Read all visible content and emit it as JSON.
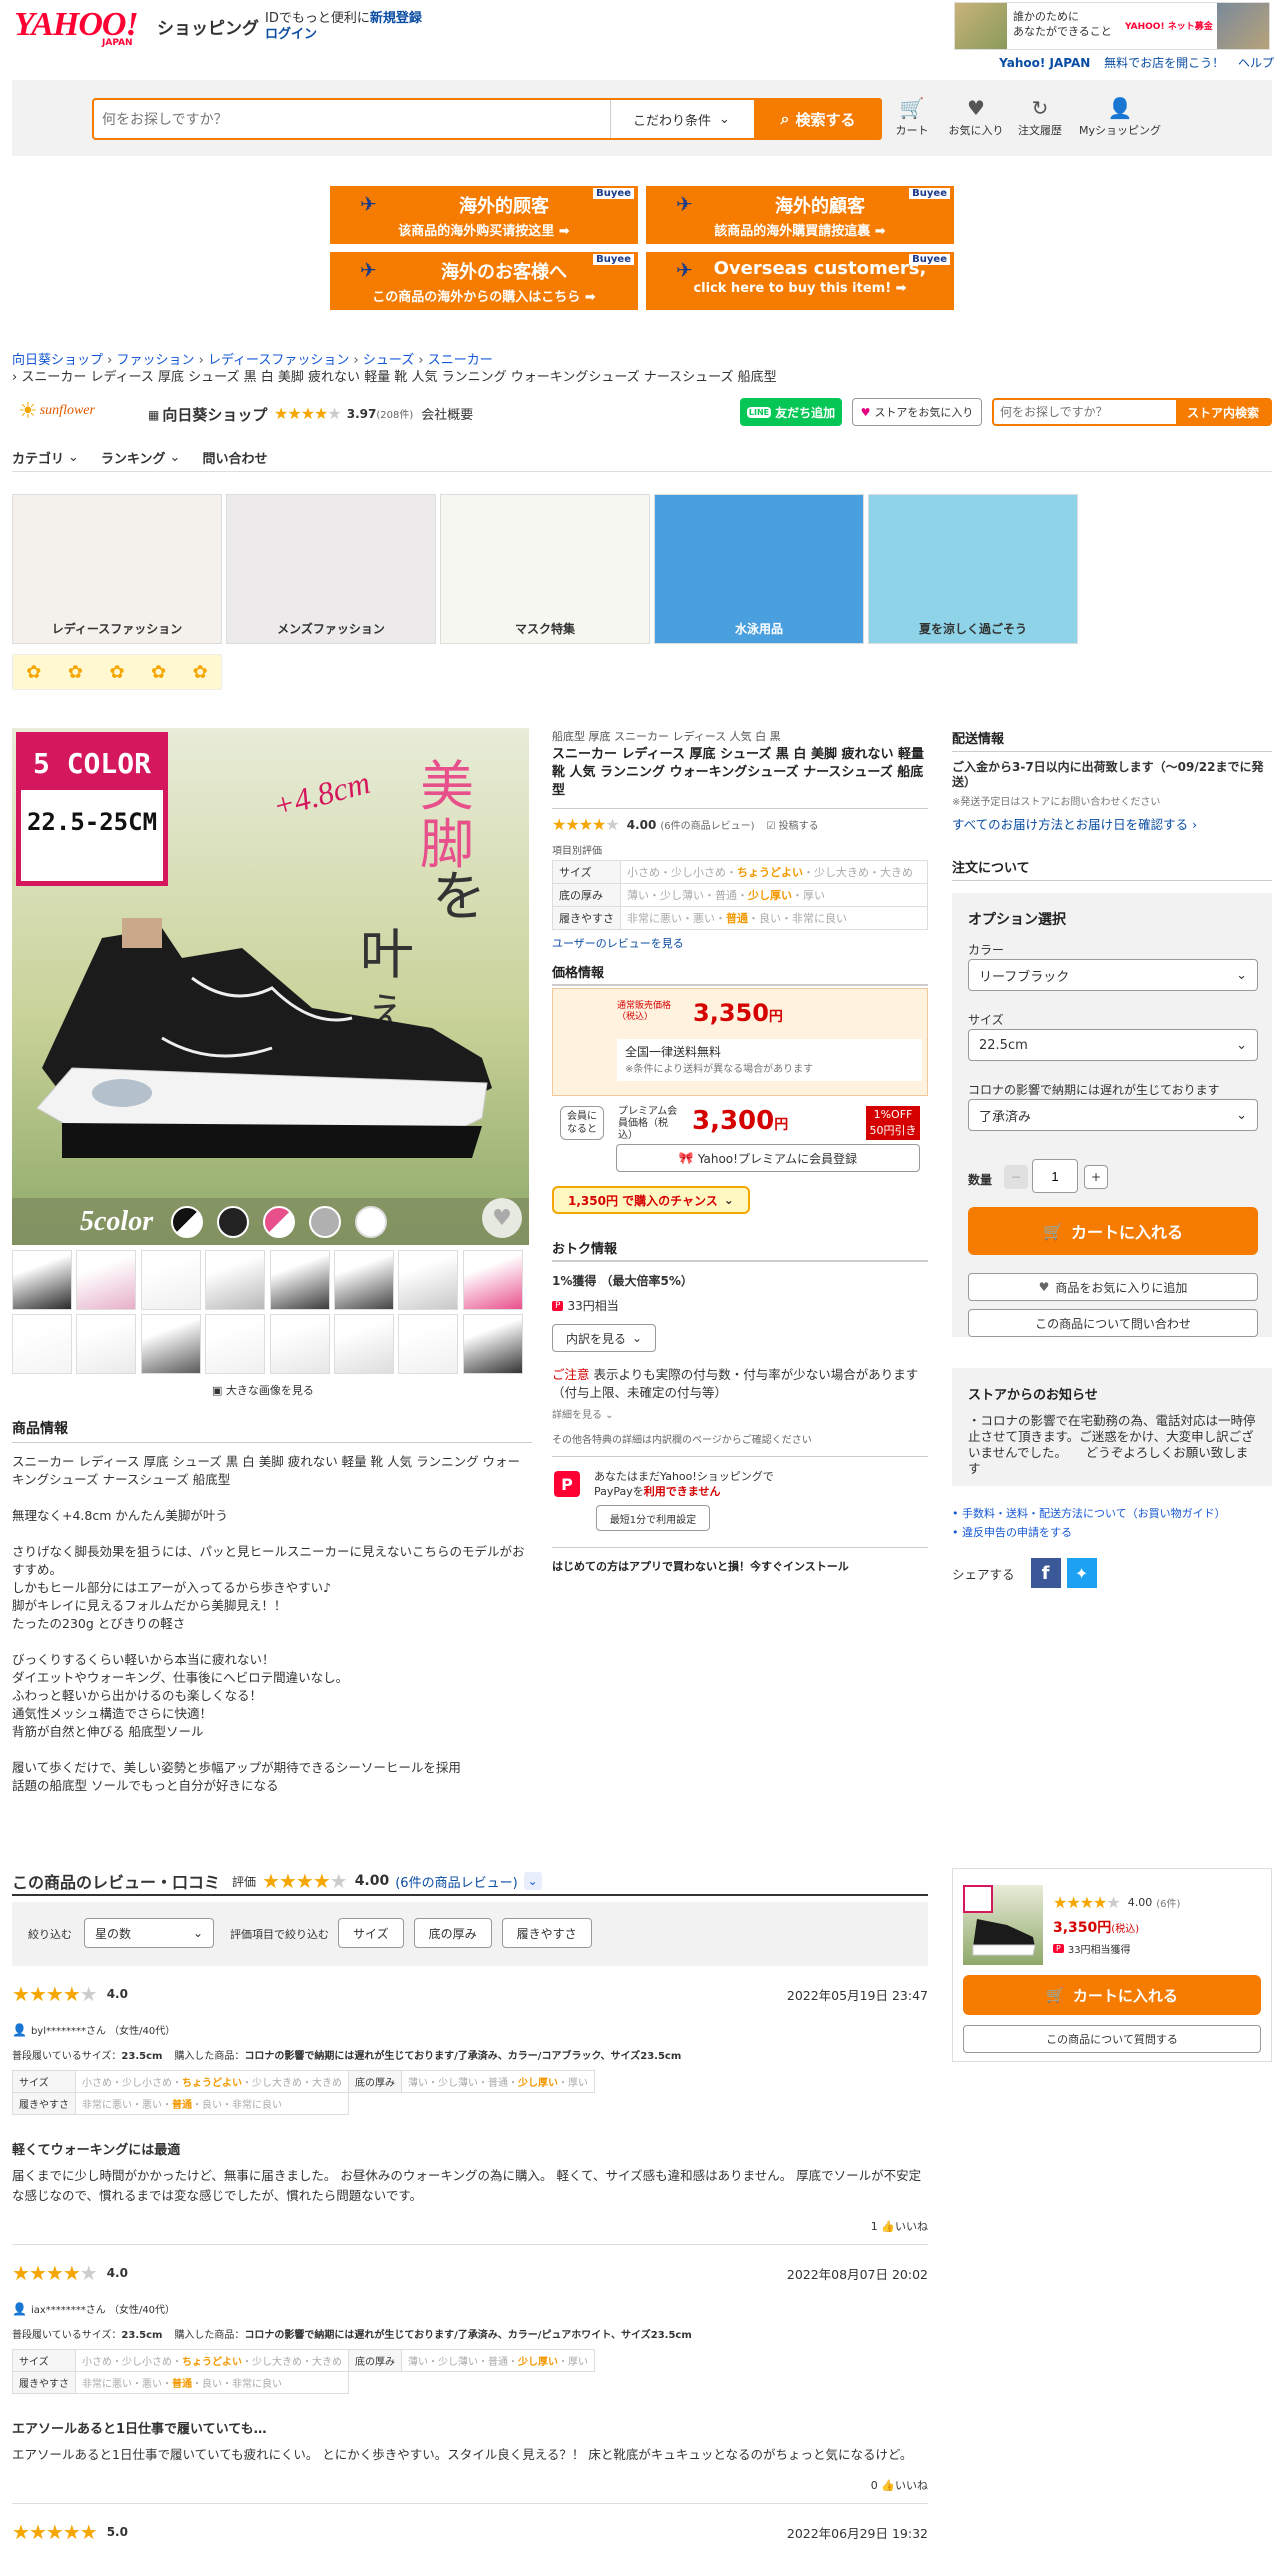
{
  "header": {
    "logo_main": "YAHOO!",
    "logo_sub": "JAPAN",
    "logo_shop": "ショッピング",
    "id_promo": "IDでもっと便利に",
    "new_reg": "新規登録",
    "login": "ログイン",
    "ad_line1": "誰かのために",
    "ad_line2": "あなたができること",
    "ad_brand": "YAHOO! ネット募金",
    "yj_link": "Yahoo! JAPAN",
    "open_store": "無料でお店を開こう！",
    "help": "ヘルプ"
  },
  "search": {
    "placeholder": "何をお探しですか？",
    "condition": "こだわり条件",
    "button": "検索する",
    "icons": [
      {
        "icon": "cart-icon",
        "label": "カート"
      },
      {
        "icon": "heart-icon",
        "label": "お気に入り"
      },
      {
        "icon": "history-icon",
        "label": "注文履歴"
      },
      {
        "icon": "user-icon",
        "label": "Myショッピング"
      }
    ]
  },
  "buyee": [
    {
      "title": "海外的顾客",
      "sub": "该商品的海外购买请按这里 ➡",
      "brand": "Buyee"
    },
    {
      "title": "海外的顧客",
      "sub": "該商品的海外購買請按這裏 ➡",
      "brand": "Buyee"
    },
    {
      "title": "海外のお客様へ",
      "sub": "この商品の海外からの購入はこちら ➡",
      "brand": "Buyee"
    },
    {
      "title": "Overseas customers,",
      "sub": "click here to buy this item! ➡",
      "brand": "Buyee"
    }
  ],
  "breadcrumb": {
    "items": [
      "向日葵ショップ",
      "ファッション",
      "レディースファッション",
      "シューズ",
      "スニーカー"
    ],
    "current": "スニーカー レディース 厚底 シューズ 黒 白 美脚 疲れない 軽量 靴 人気 ランニング ウォーキングシューズ ナースシューズ 船底型"
  },
  "store": {
    "logo_text": "sunflower",
    "name": "向日葵ショップ",
    "rating": "3.97",
    "count": "(208件)",
    "overview": "会社概要",
    "line_btn": "友だち追加",
    "fav_btn": "ストアをお気に入り",
    "search_placeholder": "何をお探しですか？",
    "search_btn": "ストア内検索"
  },
  "store_nav": [
    "カテゴリ",
    "ランキング",
    "問い合わせ"
  ],
  "banners": [
    {
      "label": "レディースファッション",
      "bg": "#f4f1ec"
    },
    {
      "label": "メンズファッション",
      "bg": "#eceaea"
    },
    {
      "label": "マスク特集",
      "bg": "#f7f7f2"
    },
    {
      "label": "水泳用品",
      "bg": "#4aa0df"
    },
    {
      "label": "夏を涼しく過ごそう",
      "bg": "#8fd3e8"
    }
  ],
  "main_image": {
    "badge_top": "5 COLOR",
    "badge_size": "22.5-25CM",
    "plus": "+4.8cm",
    "kanji1": "美",
    "kanji2": "脚",
    "kanji3": "を",
    "kanji4": "叶",
    "kanji5": "える",
    "color_label": "5color",
    "enlarge": "大きな画像を見る"
  },
  "product": {
    "subtitle": "船底型 厚底 スニーカー レディース 人気 白 黒",
    "title": "スニーカー レディース 厚底 シューズ 黒 白 美脚 疲れない 軽量 靴 人気 ランニング ウォーキングシューズ ナースシューズ 船底型",
    "rating": "4.00",
    "review_count": "(6件の商品レビュー)",
    "post_review": "投稿する",
    "eval_title": "項目別評価",
    "evals": [
      {
        "name": "サイズ",
        "opts": [
          "小さめ",
          "少し小さめ"
        ],
        "sel": "ちょうどよい",
        "opts2": [
          "少し大きめ",
          "大きめ"
        ]
      },
      {
        "name": "底の厚み",
        "opts": [
          "薄い",
          "少し薄い",
          "普通"
        ],
        "sel": "少し厚い",
        "opts2": [
          "厚い"
        ]
      },
      {
        "name": "履きやすさ",
        "opts": [
          "非常に悪い",
          "悪い"
        ],
        "sel": "普通",
        "opts2": [
          "良い",
          "非常に良い"
        ]
      }
    ],
    "user_reviews_link": "ユーザーのレビューを見る"
  },
  "price": {
    "title": "価格情報",
    "normal_label": "通常販売価格（税込）",
    "normal_price": "3,350",
    "yen": "円",
    "shipping": "全国一律送料無料",
    "shipping_note": "※条件により送料が異なる場合があります",
    "member_q": "会員になると",
    "premium_label": "プレミアム会員価格（税込）",
    "premium_price": "3,300",
    "off_badge": "1%OFF",
    "off_yen": "50円引き",
    "premium_btn": "Yahoo!プレミアムに会員登録",
    "chance": "1,350円 で購入のチャンス"
  },
  "deal": {
    "title": "おトク情報",
    "gain": "1%獲得 （最大倍率5%）",
    "points": "33円相当",
    "details_btn": "内訳を見る",
    "caution_label": "ご注意",
    "caution": "表示よりも実際の付与数・付与率が少ない場合があります（付与上限、未確定の付与等）",
    "detail_link": "詳細を見る",
    "other": "その他各特典の詳細は内訳欄のページからご確認ください",
    "paypay_line1": "あなたはまだYahoo!ショッピングで",
    "paypay_line2": "PayPayを",
    "paypay_emph": "利用できません",
    "paypay_btn": "最短1分で利用設定",
    "app_promo": "はじめての方はアプリで買わないと損！今すぐインストール"
  },
  "shipping": {
    "title": "配送情報",
    "text": "ご入金から3-7日以内に出荷致します（〜09/22までに発送）",
    "note": "※発送予定日はストアにお問い合わせください",
    "link": "すべてのお届け方法とお届け日を確認する"
  },
  "order": {
    "title": "注文について",
    "option_title": "オプション選択",
    "color_label": "カラー",
    "color_value": "リーフブラック",
    "size_label": "サイズ",
    "size_value": "22.5cm",
    "covid_label": "コロナの影響で納期には遅れが生じております",
    "covid_value": "了承済み",
    "qty_label": "数量",
    "qty_value": "1",
    "cart_btn": "カートに入れる",
    "fav_btn": "商品をお気に入りに追加",
    "inquiry_btn": "この商品について問い合わせ"
  },
  "notice": {
    "title": "ストアからのお知らせ",
    "text": "・コロナの影響で在宅勤務の為、電話対応は一時停止させて頂きます。ご迷惑をかけ、大変申し訳ございませんでした。　　どうぞよろしくお願い致します",
    "links": [
      "手数料・送料・配送方法について（お買い物ガイド）",
      "違反申告の申請をする"
    ],
    "share": "シェアする"
  },
  "description": {
    "title": "商品情報",
    "paragraphs": [
      "スニーカー レディース 厚底 シューズ 黒 白 美脚 疲れない 軽量 靴 人気 ランニング ウォーキングシューズ ナースシューズ 船底型",
      "無理なく+4.8cm かんたん美脚が叶う",
      "さりげなく脚長効果を狙うには、パッと見ヒールスニーカーに見えないこちらのモデルがおすすめ。\nしかもヒール部分にはエアーが入ってるから歩きやすい♪\n脚がキレイに見えるフォルムだから美脚見え！！\nたったの230g とびきりの軽さ",
      "びっくりするくらい軽いから本当に疲れない！\nダイエットやウォーキング、仕事後にへビロテ間違いなし。\nふわっと軽いから出かけるのも楽しくなる！\n通気性メッシュ構造でさらに快適！\n背筋が自然と伸びる 船底型ソール",
      "履いて歩くだけで、美しい姿勢と歩幅アップが期待できるシーソーヒールを採用\n話題の船底型 ソールでもっと自分が好きになる"
    ]
  },
  "reviews": {
    "title": "この商品のレビュー・口コミ",
    "eval_label": "評価",
    "rating": "4.00",
    "count_link": "(6件の商品レビュー)",
    "filter_label": "絞り込む",
    "filter_value": "星の数",
    "item_filter_label": "評価項目で絞り込む",
    "item_filters": [
      "サイズ",
      "底の厚み",
      "履きやすさ"
    ],
    "size_label": "普段履いているサイズ：",
    "purchased_label": "購入した商品：",
    "items": [
      {
        "stars": "4.0",
        "date": "2022年05月19日 23:47",
        "user": "byl********さん （女性/40代）",
        "size": "23.5cm",
        "purchased": "コロナの影響で納期には遅れが生じております/了承済み、カラー/コアブラック、サイズ23.5cm",
        "title": "軽くてウォーキングには最適",
        "body": "届くまでに少し時間がかかったけど、無事に届きました。 お昼休みのウォーキングの為に購入。 軽くて、サイズ感も違和感はありません。 厚底でソールが不安定な感じなので、慣れるまでは変な感じでしたが、慣れたら問題ないです。",
        "likes": "1",
        "like_label": "いいね"
      },
      {
        "stars": "4.0",
        "date": "2022年08月07日 20:02",
        "user": "iax********さん （女性/40代）",
        "size": "23.5cm",
        "purchased": "コロナの影響で納期には遅れが生じております/了承済み、カラー/ピュアホワイト、サイズ23.5cm",
        "title": "エアソールあると1日仕事で履いていても…",
        "body": "エアソールあると1日仕事で履いていても疲れにくい。 とにかく歩きやすい。スタイル良く見える？！ 床と靴底がキュキュッとなるのがちょっと気になるけど。",
        "likes": "0",
        "like_label": "いいね"
      },
      {
        "stars": "5.0",
        "date": "2022年06月29日 19:32"
      }
    ]
  },
  "sticky": {
    "rating": "4.00",
    "count": "(6件)",
    "price": "3,350円",
    "tax": "(税込)",
    "points": "33円相当獲得",
    "cart_btn": "カートに入れる",
    "inquiry_btn": "この商品について質問する"
  },
  "colors": {
    "brand_red": "#ff0033",
    "orange": "#f57c00",
    "price_red": "#d50000",
    "link": "#1558d6"
  }
}
